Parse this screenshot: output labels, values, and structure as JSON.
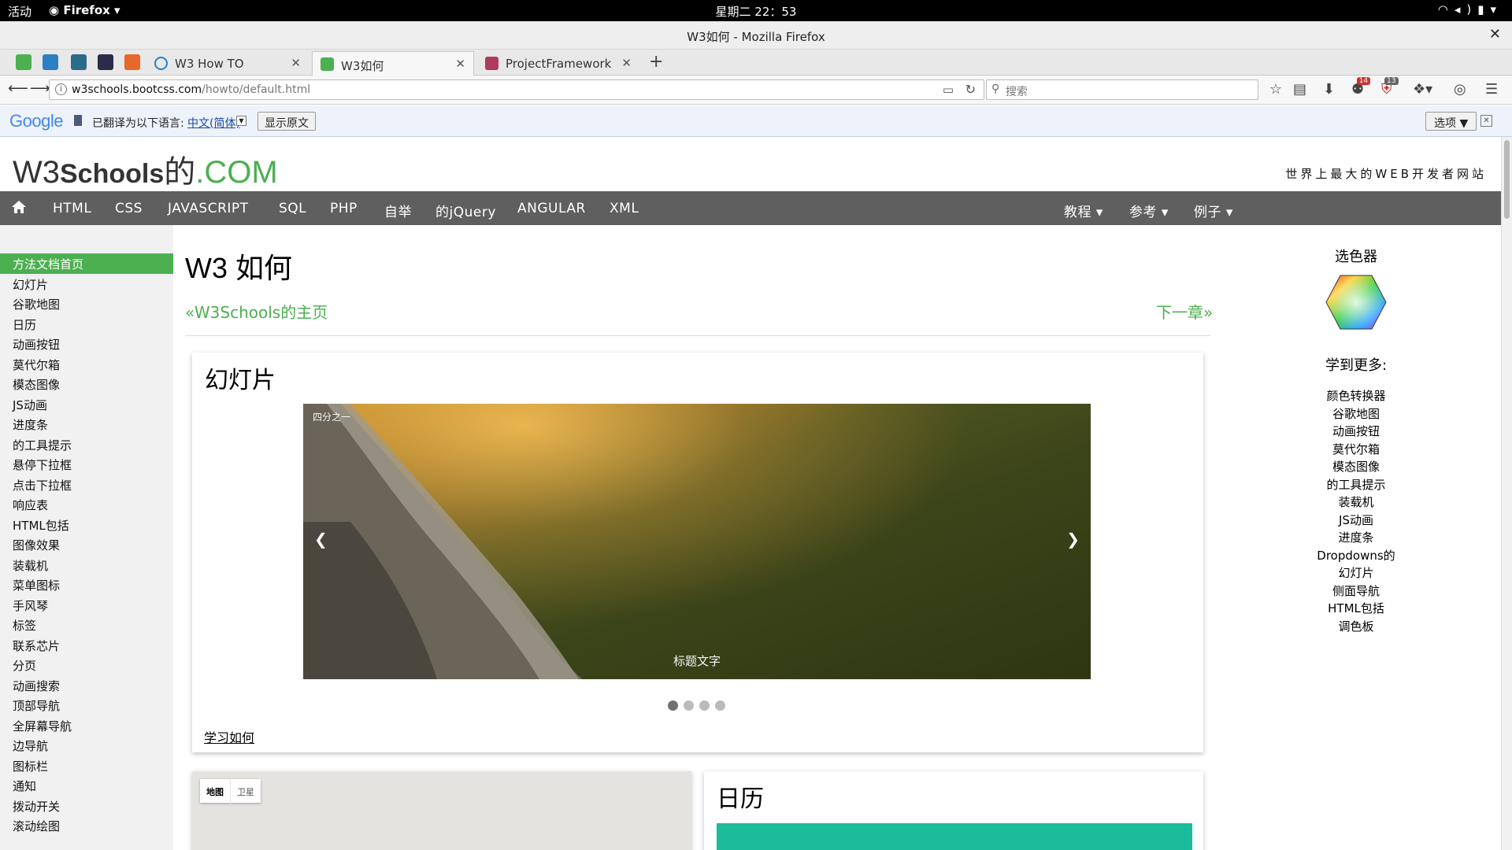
{
  "system": {
    "activities": "活动",
    "app_menu": "Firefox",
    "clock": "星期二 22：53"
  },
  "window": {
    "title": "W3如何 - Mozilla Firefox"
  },
  "tabs": [
    {
      "title": "W3 How TO",
      "active": false
    },
    {
      "title": "W3如何",
      "active": true
    },
    {
      "title": "ProjectFramework",
      "active": false
    }
  ],
  "navigation": {
    "url_host": "w3schools.bootcss.com",
    "url_path": "/howto/default.html",
    "search_placeholder": "搜索",
    "badges": {
      "addon_a": "14",
      "addon_b": "13"
    }
  },
  "translate_bar": {
    "logo": "Google",
    "label": "已翻译为以下语言:",
    "language": "中文(简体)",
    "show_original": "显示原文",
    "options": "选项 ▼"
  },
  "site": {
    "logo_w3": "W3",
    "logo_schools": "Schools",
    "logo_de": "的",
    "logo_com": ".COM",
    "tagline": "世界上最大的WEB开发者网站",
    "menu": [
      "HTML",
      "CSS",
      "JAVASCRIPT",
      "SQL",
      "PHP",
      "自举",
      "的jQuery",
      "ANGULAR",
      "XML"
    ],
    "menu_right": [
      "教程",
      "参考",
      "例子"
    ]
  },
  "sidebar": {
    "items": [
      "方法文档首页",
      "幻灯片",
      "谷歌地图",
      "日历",
      "动画按钮",
      "莫代尔箱",
      "模态图像",
      "JS动画",
      "进度条",
      "的工具提示",
      "悬停下拉框",
      "点击下拉框",
      "响应表",
      "HTML包括",
      "图像效果",
      "装载机",
      "菜单图标",
      "手风琴",
      "标签",
      "联系芯片",
      "分页",
      "动画搜索",
      "顶部导航",
      "全屏幕导航",
      "边导航",
      "图标栏",
      "通知",
      "拨动开关",
      "滚动绘图"
    ]
  },
  "main": {
    "title": "W3 如何",
    "prev_link": "«W3Schools的主页",
    "next_link": "下一章»",
    "slideshow": {
      "heading": "幻灯片",
      "number_text": "四分之一",
      "caption": "标题文字",
      "prev": "❮",
      "next": "❯",
      "dot_count": 4,
      "active_dot": 1,
      "learn_link": "学习如何"
    },
    "map": {
      "map_btn": "地图",
      "satellite_btn": "卫星"
    },
    "calendar": {
      "heading": "日历",
      "accent_color": "#1abc9c"
    }
  },
  "right_column": {
    "color_picker_title": "选色器",
    "learn_more_title": "学到更多:",
    "links": [
      "颜色转换器",
      "谷歌地图",
      "动画按钮",
      "莫代尔箱",
      "模态图像",
      "的工具提示",
      "装载机",
      "JS动画",
      "进度条",
      "Dropdowns的",
      "幻灯片",
      "侧面导航",
      "HTML包括",
      "调色板"
    ]
  },
  "colors": {
    "brand_green": "#4CAF50",
    "menubar": "#5f5f5f",
    "sidebar_bg": "#f1f1f1"
  }
}
